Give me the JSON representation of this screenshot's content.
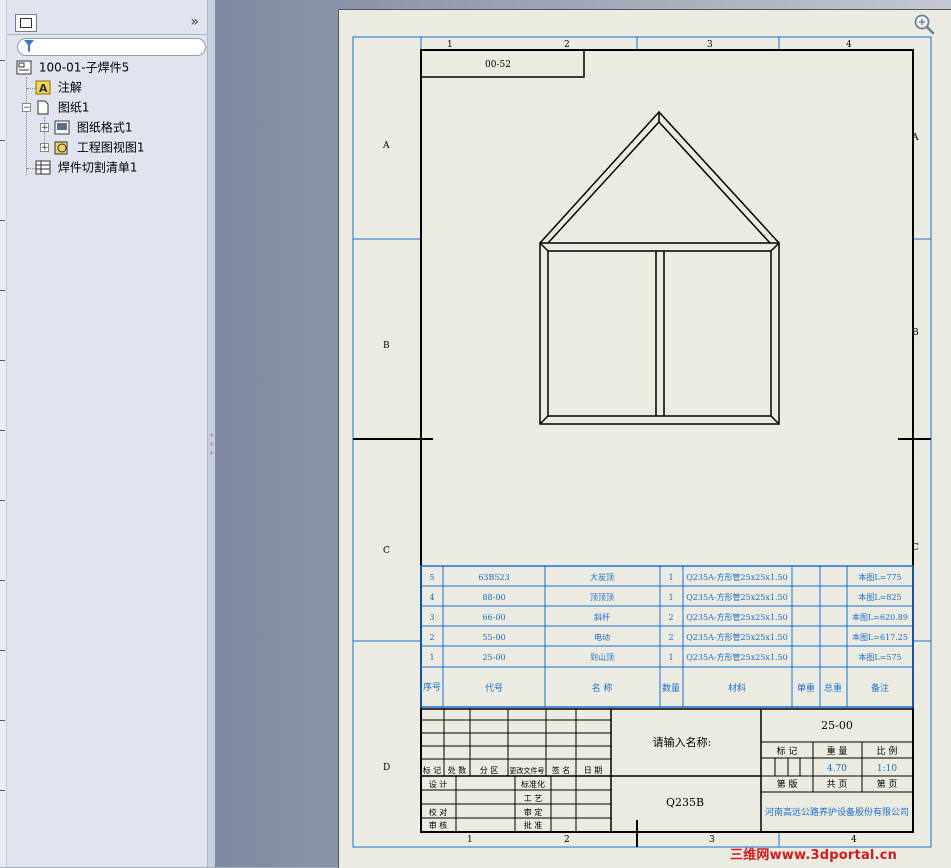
{
  "panel": {
    "collapse_glyph": "»",
    "filter_icon": "funnel-icon",
    "tree": {
      "root": "100-01-子焊件5",
      "annotations": "注解",
      "sheet": "图纸1",
      "sheet_format": "图纸格式1",
      "drawing_view": "工程图视图1",
      "cut_list": "焊件切割清单1"
    }
  },
  "drawing": {
    "zones_top": [
      "1",
      "2",
      "3",
      "4"
    ],
    "zones_side": [
      "A",
      "B",
      "C",
      "D"
    ],
    "top_left_label": "00-52",
    "bom_rows": [
      {
        "no": "5",
        "code": "63B523",
        "name": "大炭顶",
        "qty": "1",
        "material": "Q235A-方形管25x25x1.50",
        "unit_weight": "",
        "total_weight": "",
        "remark": "本图L=775"
      },
      {
        "no": "4",
        "code": "88-00",
        "name": "顶顶顶",
        "qty": "1",
        "material": "Q235A-方形管25x25x1.50",
        "unit_weight": "",
        "total_weight": "",
        "remark": "本图L=825"
      },
      {
        "no": "3",
        "code": "66-00",
        "name": "斜杆",
        "qty": "2",
        "material": "Q235A-方形管25x25x1.50",
        "unit_weight": "",
        "total_weight": "",
        "remark": "本图L=620.89"
      },
      {
        "no": "2",
        "code": "55-00",
        "name": "电动",
        "qty": "2",
        "material": "Q235A-方形管25x25x1.50",
        "unit_weight": "",
        "total_weight": "",
        "remark": "本图L=617.25"
      },
      {
        "no": "1",
        "code": "25-00",
        "name": "到山顶",
        "qty": "1",
        "material": "Q235A-方形管25x25x1.50",
        "unit_weight": "",
        "total_weight": "",
        "remark": "本图L=575"
      }
    ],
    "bom_header": {
      "no": "序号",
      "code": "代号",
      "name": "名 称",
      "qty": "数量",
      "material": "材料",
      "unit_weight": "单重",
      "total_weight": "总重",
      "remark": "备注"
    },
    "title_block": {
      "name_prompt": "请输入名称:",
      "drawing_no": "25-00",
      "material": "Q235B",
      "company": "河南高远公路养护设备股份有限公司",
      "label_mark": "标 记",
      "label_weight": "重 量",
      "label_scale": "比 例",
      "weight": "4.70",
      "scale": "1:10",
      "sheet_count": "共 页",
      "sheet_no": "第 页",
      "sheet_prefix": "第 版",
      "rev_cols": [
        "标 记",
        "处 数",
        "分 区",
        "更改文件号",
        "签 名",
        "日 期"
      ],
      "sign_labels": [
        "设 计",
        "校 对",
        "审 核"
      ],
      "approval_labels": [
        "标准化",
        "工 艺",
        "审 定",
        "批 准"
      ]
    }
  },
  "watermark": "三维网www.3dportal.cn",
  "colors": {
    "frame": "#000000",
    "grid_blue": "#1a6fd1",
    "sheet": "#ecebe2",
    "watermark": "#d21d1d"
  }
}
